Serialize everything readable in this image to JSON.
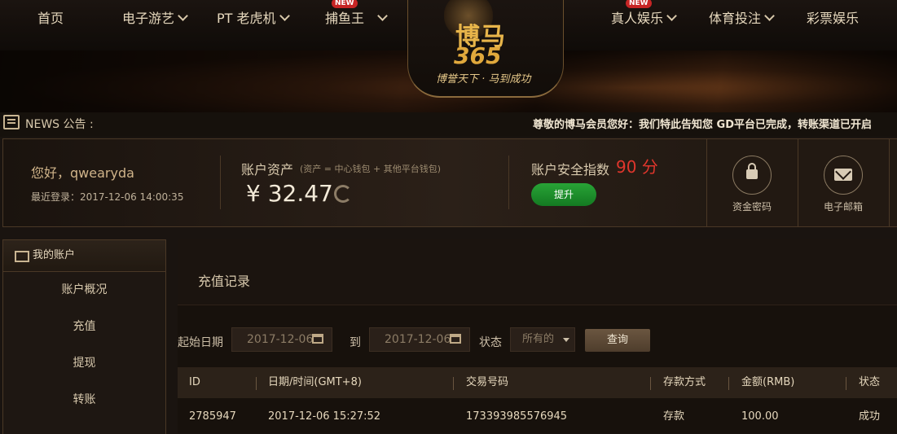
{
  "nav": {
    "home": "首页",
    "egames": "电子游艺",
    "pt": "PT 老虎机",
    "fishing": "捕鱼王",
    "fishing_badge": "NEW",
    "live": "真人娱乐",
    "live_badge": "NEW",
    "sports": "体育投注",
    "lottery": "彩票娱乐"
  },
  "logo": {
    "main": "博马",
    "number": "365",
    "slogan": "博誉天下 · 马到成功"
  },
  "news": {
    "label": "NEWS 公告 :",
    "marquee": "尊敬的博马会员您好：我们特此告知您 GD平台已完成，转账渠道已开启"
  },
  "account": {
    "greeting": "您好，qwearyda",
    "last_login": "最近登录：2017-12-06 14:00:35",
    "assets_title": "账户资产",
    "assets_note": "(资产 = 中心钱包 + 其他平台钱包)",
    "balance": "¥ 32.47",
    "safety_title": "账户安全指数",
    "safety_score": "90 分",
    "upgrade": "提升",
    "tile_password": "资金密码",
    "tile_email": "电子邮箱"
  },
  "sidebar": {
    "header": "我的账户",
    "items": [
      "账户概况",
      "充值",
      "提现",
      "转账"
    ]
  },
  "main": {
    "title": "充值记录",
    "filter": {
      "start_label": "起始日期",
      "start_value": "2017-12-06",
      "to_label": "到",
      "end_value": "2017-12-06",
      "status_label": "状态",
      "status_value": "所有的",
      "query": "查询"
    },
    "table": {
      "headers": [
        "ID",
        "日期/时间(GMT+8)",
        "交易号码",
        "存款方式",
        "金额(RMB)",
        "状态"
      ],
      "rows": [
        [
          "2785947",
          "2017-12-06 15:27:52",
          "173393985576945",
          "存款",
          "100.00",
          "成功"
        ]
      ]
    }
  }
}
